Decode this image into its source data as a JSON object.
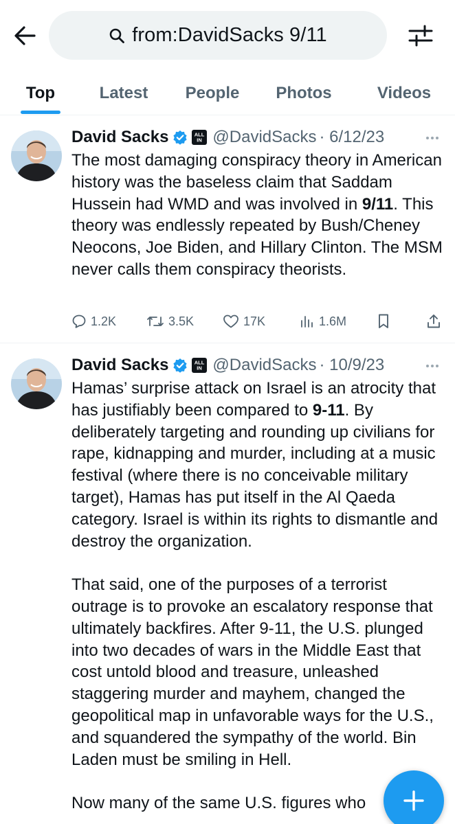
{
  "search": {
    "query": "from:DavidSacks 9/11"
  },
  "tabs": [
    {
      "label": "Top",
      "active": true
    },
    {
      "label": "Latest",
      "active": false
    },
    {
      "label": "People",
      "active": false
    },
    {
      "label": "Photos",
      "active": false
    },
    {
      "label": "Videos",
      "active": false
    }
  ],
  "tweets": [
    {
      "author_name": "David Sacks",
      "affiliation_badge": "ALL IN",
      "handle": "@DavidSacks",
      "date": "· 6/12/23",
      "paragraphs": [
        [
          {
            "t": "The most damaging conspiracy theory in American history was the baseless claim that Saddam Hussein had WMD and was involved in ",
            "b": false
          },
          {
            "t": "9/11",
            "b": true
          },
          {
            "t": ". This theory was endlessly repeated by Bush/Cheney Neocons, Joe Biden, and Hillary Clinton. The MSM never calls them conspiracy theorists.",
            "b": false
          }
        ]
      ],
      "stats": {
        "replies": "1.2K",
        "reposts": "3.5K",
        "likes": "17K",
        "views": "1.6M"
      }
    },
    {
      "author_name": "David Sacks",
      "affiliation_badge": "ALL IN",
      "handle": "@DavidSacks",
      "date": "· 10/9/23",
      "paragraphs": [
        [
          {
            "t": "Hamas’ surprise attack on Israel is an atrocity that has justifiably been compared to ",
            "b": false
          },
          {
            "t": "9-11",
            "b": true
          },
          {
            "t": ". By deliberately targeting and rounding up civilians for rape, kidnapping and murder, including at a music festival (where there is no conceivable military target), Hamas has put itself in the Al Qaeda category. Israel is within its rights to dismantle and destroy the organization.",
            "b": false
          }
        ],
        [
          {
            "t": "That said, one of the purposes of a terrorist outrage is to provoke an escalatory response that ultimately backfires. After 9-11, the U.S. plunged into two decades of wars in the Middle East that cost untold blood and treasure, unleashed staggering murder and mayhem, changed the geopolitical map in unfavorable ways for the U.S., and squandered the sympathy of the world. Bin Laden must be smiling in Hell.",
            "b": false
          }
        ],
        [
          {
            "t": "Now many of the same U.S. figures who",
            "b": false
          }
        ]
      ]
    }
  ],
  "icons": {
    "back": "arrow-left-icon",
    "search": "magnifier-icon",
    "filter": "sliders-icon",
    "more": "ellipsis-icon",
    "reply": "speech-bubble-icon",
    "repost": "repost-icon",
    "like": "heart-icon",
    "views": "bar-chart-icon",
    "bookmark": "bookmark-icon",
    "share": "share-icon",
    "compose": "plus-icon"
  },
  "colors": {
    "accent": "#1d9bf0",
    "text_primary": "#0f1419",
    "text_secondary": "#536471",
    "divider": "#eff3f4"
  }
}
